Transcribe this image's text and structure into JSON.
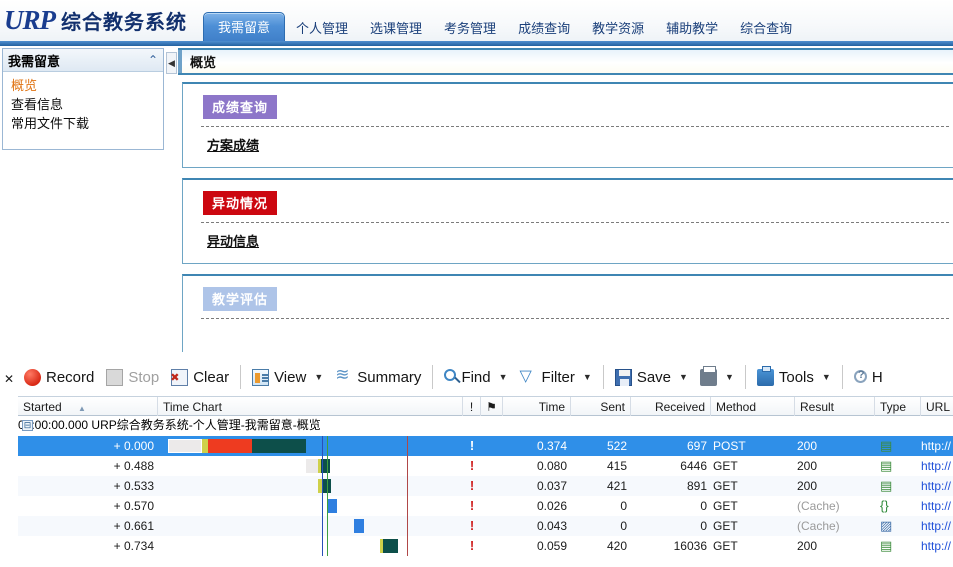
{
  "app": {
    "logo_latin": "URP",
    "logo_cn": "综合教务系统"
  },
  "tabs": [
    {
      "label": "我需留意",
      "active": true
    },
    {
      "label": "个人管理",
      "active": false
    },
    {
      "label": "选课管理",
      "active": false
    },
    {
      "label": "考务管理",
      "active": false
    },
    {
      "label": "成绩查询",
      "active": false
    },
    {
      "label": "教学资源",
      "active": false
    },
    {
      "label": "辅助教学",
      "active": false
    },
    {
      "label": "综合查询",
      "active": false
    }
  ],
  "sidebar": {
    "title": "我需留意",
    "collapse_icon": "chevron-up-icon",
    "items": [
      {
        "label": "概览",
        "active": true
      },
      {
        "label": "查看信息",
        "active": false
      },
      {
        "label": "常用文件下载",
        "active": false
      }
    ]
  },
  "splitter": {
    "icon": "◀"
  },
  "content": {
    "breadcrumb": "概览",
    "panels": [
      {
        "badge": "成绩查询",
        "badge_color": "#8d76c9",
        "link": "方案成绩"
      },
      {
        "badge": "异动情况",
        "badge_color": "#cc0710",
        "link": "异动信息"
      },
      {
        "badge": "教学评估",
        "badge_color": "#aec4e8",
        "link": ""
      }
    ]
  },
  "debugger": {
    "close_label": "✕",
    "toolbar": [
      {
        "label": "Record",
        "icon": "record-icon",
        "caret": false,
        "disabled": false
      },
      {
        "label": "Stop",
        "icon": "stop-icon",
        "caret": false,
        "disabled": true
      },
      {
        "label": "Clear",
        "icon": "clear-icon",
        "caret": false,
        "disabled": false
      },
      {
        "label": "View",
        "icon": "view-icon",
        "caret": true,
        "disabled": false
      },
      {
        "label": "Summary",
        "icon": "summary-icon",
        "caret": false,
        "disabled": false
      },
      {
        "label": "Find",
        "icon": "find-icon",
        "caret": true,
        "disabled": false
      },
      {
        "label": "Filter",
        "icon": "filter-icon",
        "caret": true,
        "disabled": false
      },
      {
        "label": "Save",
        "icon": "save-icon",
        "caret": true,
        "disabled": false
      },
      {
        "label": "",
        "icon": "print-icon",
        "caret": true,
        "disabled": false
      },
      {
        "label": "Tools",
        "icon": "tools-icon",
        "caret": true,
        "disabled": false
      },
      {
        "label": "H",
        "icon": "help-icon",
        "caret": false,
        "disabled": false
      }
    ],
    "columns": [
      {
        "key": "started",
        "label": "Started",
        "sorted": "asc"
      },
      {
        "key": "timechart",
        "label": "Time Chart"
      },
      {
        "key": "warn",
        "label": "!"
      },
      {
        "key": "flag",
        "label": "⚑"
      },
      {
        "key": "time",
        "label": "Time"
      },
      {
        "key": "sent",
        "label": "Sent"
      },
      {
        "key": "received",
        "label": "Received"
      },
      {
        "key": "method",
        "label": "Method"
      },
      {
        "key": "result",
        "label": "Result"
      },
      {
        "key": "type",
        "label": "Type"
      },
      {
        "key": "url",
        "label": "URL"
      }
    ],
    "group": {
      "time": "00:00:00.000",
      "title": "URP综合教务系统-个人管理-我需留意-概览",
      "toggle": "⊟"
    },
    "rows": [
      {
        "started": "+ 0.000",
        "warn": "!",
        "time": "0.374",
        "sent": "522",
        "received": "697",
        "method": "POST",
        "result": "200",
        "type": "doc-icon",
        "url": "http://",
        "selected": true
      },
      {
        "started": "+ 0.488",
        "warn": "!",
        "time": "0.080",
        "sent": "415",
        "received": "6446",
        "method": "GET",
        "result": "200",
        "type": "doc-icon",
        "url": "http://",
        "selected": false
      },
      {
        "started": "+ 0.533",
        "warn": "!",
        "time": "0.037",
        "sent": "421",
        "received": "891",
        "method": "GET",
        "result": "200",
        "type": "doc-icon",
        "url": "http://",
        "selected": false
      },
      {
        "started": "+ 0.570",
        "warn": "!",
        "time": "0.026",
        "sent": "0",
        "received": "0",
        "method": "GET",
        "result": "(Cache)",
        "type": "json-icon",
        "url": "http://",
        "selected": false
      },
      {
        "started": "+ 0.661",
        "warn": "!",
        "time": "0.043",
        "sent": "0",
        "received": "0",
        "method": "GET",
        "result": "(Cache)",
        "type": "image-icon",
        "url": "http://",
        "selected": false
      },
      {
        "started": "+ 0.734",
        "warn": "!",
        "time": "0.059",
        "sent": "420",
        "received": "16036",
        "method": "GET",
        "result": "200",
        "type": "doc-icon",
        "url": "http://",
        "selected": false
      }
    ]
  }
}
